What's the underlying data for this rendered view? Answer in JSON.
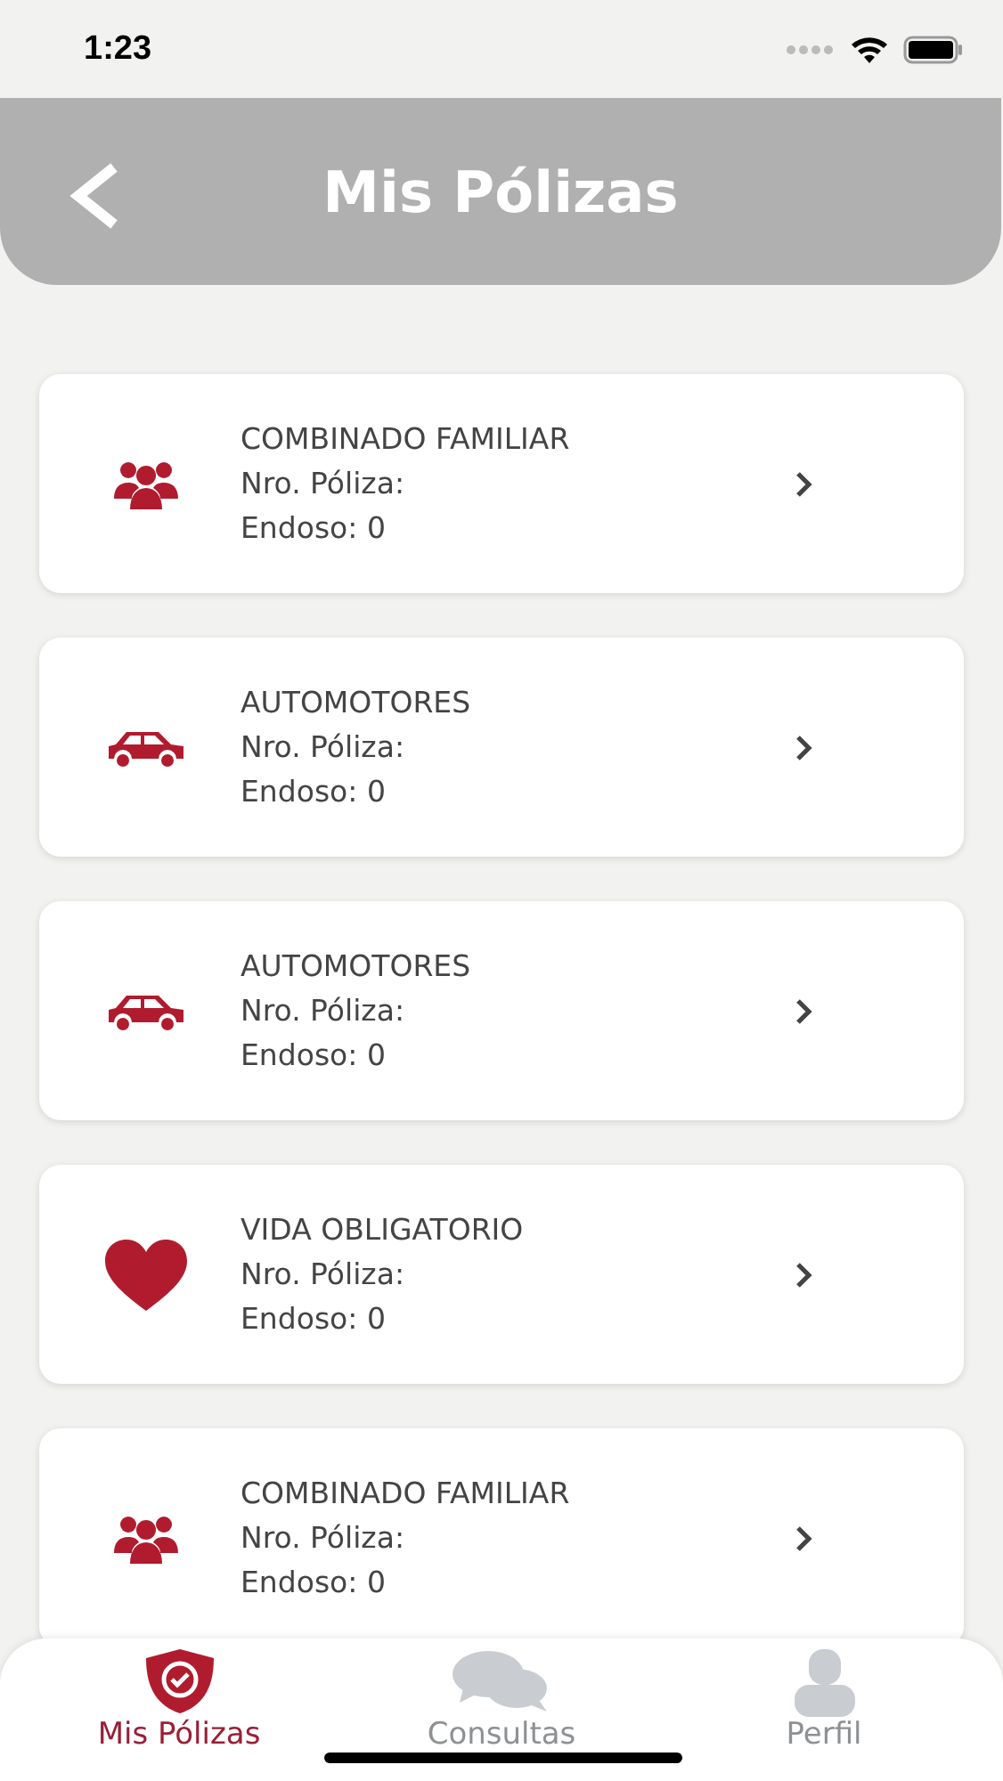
{
  "status_bar": {
    "time": "1:23"
  },
  "header": {
    "title": "Mis Pólizas"
  },
  "policies": [
    {
      "kind": "family",
      "name": "COMBINADO FAMILIAR",
      "policy_number": "Nro. Póliza:",
      "endorsement": "Endoso: 0"
    },
    {
      "kind": "car",
      "name": "AUTOMOTORES",
      "policy_number": "Nro. Póliza:",
      "endorsement": "Endoso: 0"
    },
    {
      "kind": "car",
      "name": "AUTOMOTORES",
      "policy_number": "Nro. Póliza:",
      "endorsement": "Endoso: 0"
    },
    {
      "kind": "heart",
      "name": "VIDA OBLIGATORIO",
      "policy_number": "Nro. Póliza:",
      "endorsement": "Endoso: 0"
    },
    {
      "kind": "family",
      "name": "COMBINADO FAMILIAR",
      "policy_number": "Nro. Póliza:",
      "endorsement": "Endoso: 0"
    }
  ],
  "tabs": [
    {
      "kind": "shield",
      "label": "Mis Pólizas",
      "selected": true
    },
    {
      "kind": "chat",
      "label": "Consultas",
      "selected": false
    },
    {
      "kind": "person",
      "label": "Perfil",
      "selected": false
    }
  ]
}
